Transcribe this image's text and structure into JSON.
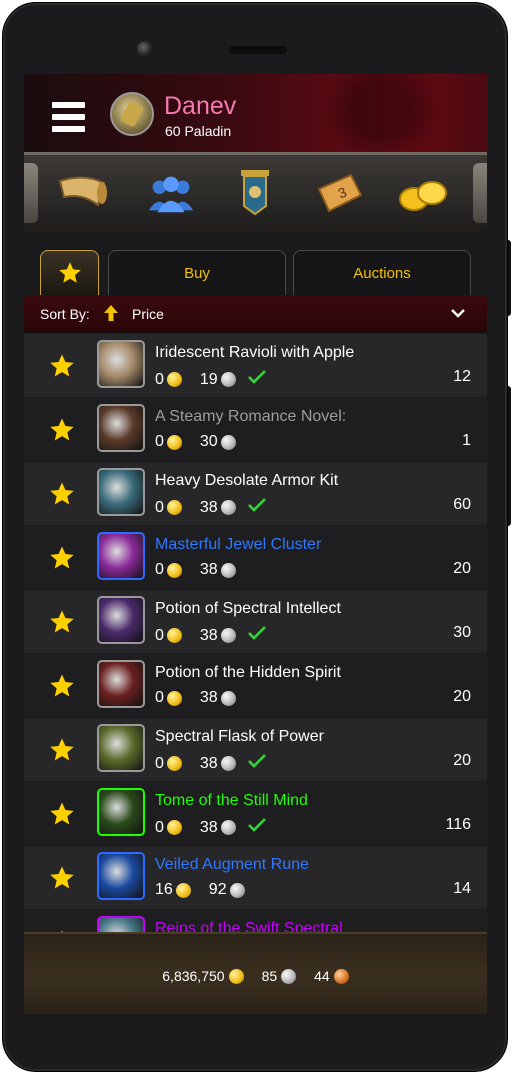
{
  "character": {
    "name": "Danev",
    "subtitle": "60 Paladin"
  },
  "nav_icons": [
    "horn-icon",
    "guild-icon",
    "banner-icon",
    "calendar-icon",
    "gold-coins-icon"
  ],
  "tabs": [
    {
      "label": ""
    },
    {
      "label": "Buy"
    },
    {
      "label": "Auctions"
    }
  ],
  "sort": {
    "label": "Sort By:",
    "value": "Price"
  },
  "items": [
    {
      "name": "Iridescent Ravioli with Apple",
      "color": "#ffffff",
      "gold": "0",
      "silver": "19",
      "check": true,
      "qty": "12",
      "thumb": "#a58a6a",
      "border": "#9a9a9a"
    },
    {
      "name": "A Steamy Romance Novel:",
      "color": "#9d9d9d",
      "gold": "0",
      "silver": "30",
      "check": false,
      "qty": "1",
      "thumb": "#5a3a2a",
      "border": "#9a9a9a"
    },
    {
      "name": "Heavy Desolate Armor Kit",
      "color": "#ffffff",
      "gold": "0",
      "silver": "38",
      "check": true,
      "qty": "60",
      "thumb": "#3a6a7a",
      "border": "#9a9a9a"
    },
    {
      "name": "Masterful Jewel Cluster",
      "color": "#2f78ff",
      "gold": "0",
      "silver": "38",
      "check": false,
      "qty": "20",
      "thumb": "#8a2a9a",
      "border": "#2f6aff"
    },
    {
      "name": "Potion of Spectral Intellect",
      "color": "#ffffff",
      "gold": "0",
      "silver": "38",
      "check": true,
      "qty": "30",
      "thumb": "#4a2a6a",
      "border": "#9a9a9a"
    },
    {
      "name": "Potion of the Hidden Spirit",
      "color": "#ffffff",
      "gold": "0",
      "silver": "38",
      "check": false,
      "qty": "20",
      "thumb": "#6a2020",
      "border": "#9a9a9a"
    },
    {
      "name": "Spectral Flask of Power",
      "color": "#ffffff",
      "gold": "0",
      "silver": "38",
      "check": true,
      "qty": "20",
      "thumb": "#5a6a2a",
      "border": "#9a9a9a"
    },
    {
      "name": "Tome of the Still Mind",
      "color": "#1eff00",
      "gold": "0",
      "silver": "38",
      "check": true,
      "qty": "116",
      "thumb": "#2a4a1a",
      "border": "#1eff00"
    },
    {
      "name": "Veiled Augment Rune",
      "color": "#2f78ff",
      "gold": "16",
      "silver": "92",
      "check": false,
      "qty": "14",
      "thumb": "#1a4aa0",
      "border": "#2f6aff"
    },
    {
      "name": "Reins of the Swift Spectral",
      "color": "#c600ff",
      "gold": "",
      "silver": "",
      "check": false,
      "qty": "",
      "thumb": "#4a7a8a",
      "border": "#c600ff"
    }
  ],
  "footer": {
    "gold": "6,836,750",
    "silver": "85",
    "copper": "44"
  }
}
